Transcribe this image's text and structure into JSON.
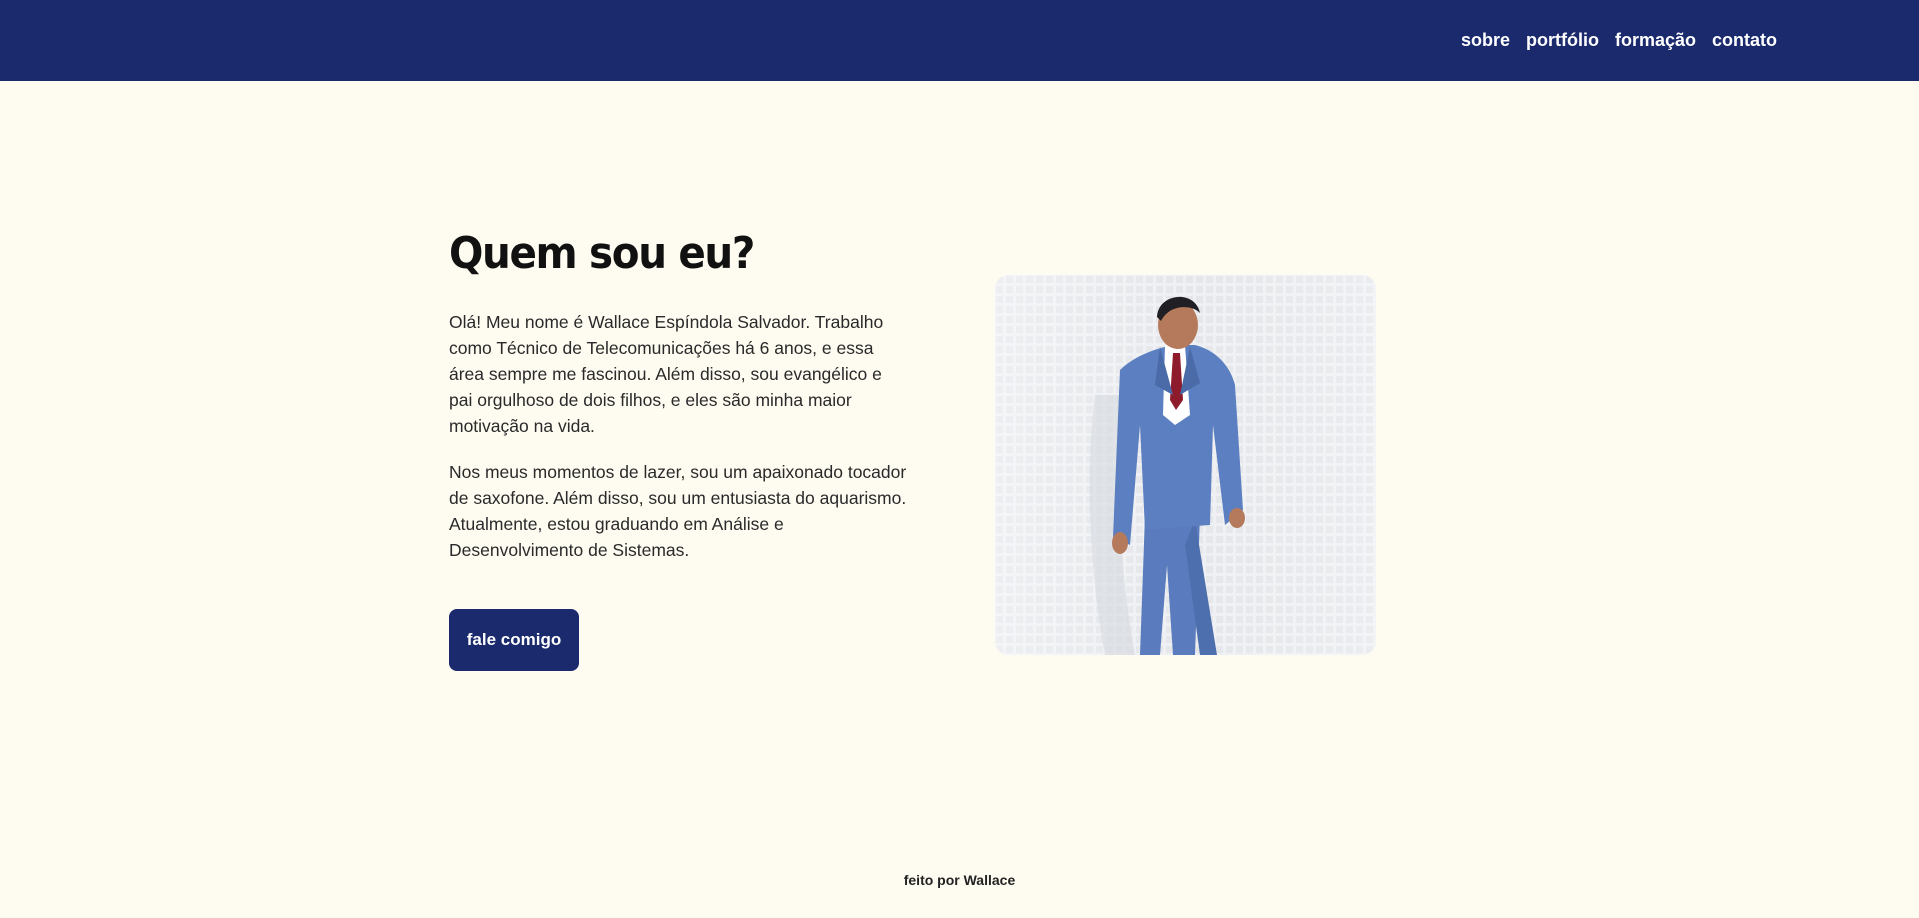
{
  "nav": {
    "items": [
      {
        "label": "sobre"
      },
      {
        "label": "portfólio"
      },
      {
        "label": "formação"
      },
      {
        "label": "contato"
      }
    ]
  },
  "about": {
    "title": "Quem sou eu?",
    "paragraph1": "Olá! Meu nome é Wallace Espíndola Salvador. Trabalho como Técnico de Telecomunicações há 6 anos, e essa área sempre me fascinou. Além disso, sou evangélico e pai orgulhoso de dois filhos, e eles são minha maior motivação na vida.",
    "paragraph2": "Nos meus momentos de lazer, sou um apaixonado tocador de saxofone. Além disso, sou um entusiasta do aquarismo. Atualmente, estou graduando em Análise e Desenvolvimento de Sistemas.",
    "cta_label": "fale comigo"
  },
  "footer": {
    "text": "feito por Wallace"
  },
  "colors": {
    "navy": "#1a2a6c",
    "background": "#fefbf1",
    "suit_blue": "#5b7fc0"
  }
}
